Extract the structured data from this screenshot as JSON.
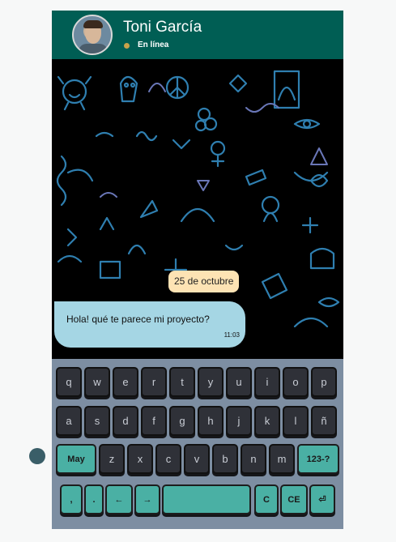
{
  "contact": {
    "name": "Toni García",
    "status": "En línea",
    "status_color": "#c8a24a"
  },
  "colors": {
    "header": "#005e54",
    "accent": "#4ab0a4",
    "bubble": "#a5d6e4",
    "date_badge": "#fde3b4",
    "keyboard": "#7d8ea2"
  },
  "chat": {
    "date_label": "25 de octubre",
    "messages": [
      {
        "text": "Hola! qué te parece mi proyecto?",
        "time": "11:03"
      }
    ]
  },
  "composer": {
    "value": "",
    "emoji_icon": "smiley-icon",
    "send_icon": "paper-plane-icon"
  },
  "keyboard": {
    "row1": [
      "q",
      "w",
      "e",
      "r",
      "t",
      "y",
      "u",
      "i",
      "o",
      "p"
    ],
    "row2": [
      "a",
      "s",
      "d",
      "f",
      "g",
      "h",
      "j",
      "k",
      "l",
      "ñ"
    ],
    "row3": [
      "May",
      "z",
      "x",
      "c",
      "v",
      "b",
      "n",
      "m",
      "123-?"
    ],
    "row4": [
      ",",
      ".",
      "←",
      "→",
      "",
      "C",
      "CE",
      "⏎"
    ]
  }
}
